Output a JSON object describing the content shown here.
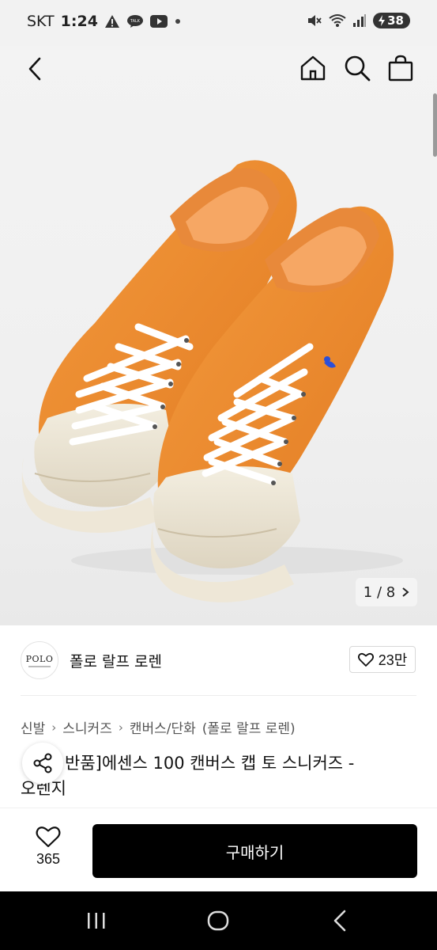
{
  "status_bar": {
    "carrier": "SKT",
    "time": "1:24",
    "battery": "38",
    "left_icons": [
      "talk-icon",
      "youtube-icon",
      "dot-icon"
    ],
    "right_icons": [
      "mute-icon",
      "wifi-icon",
      "signal-icon",
      "battery-icon"
    ]
  },
  "header": {
    "icons": [
      "back-icon",
      "home-icon",
      "search-icon",
      "bag-icon"
    ]
  },
  "gallery": {
    "counter": "1 / 8",
    "colors": {
      "canvas": "#f08a2c",
      "sole": "#ece5d3",
      "lace": "#ffffff",
      "logo": "#2b4fd8"
    }
  },
  "brand": {
    "logo_text": "POLO",
    "name": "폴로 랄프 로렌",
    "likes": "23만"
  },
  "breadcrumb": [
    "신발",
    "스니커즈",
    "캔버스/단화",
    "(폴로 랄프 로렌)"
  ],
  "product": {
    "title_line1": "반품]에센스 100 캔버스 캡 토 스니커즈 -",
    "title_line2": "오렌지"
  },
  "bottom": {
    "wish_count": "365",
    "buy_label": "구매하기",
    "buy_color": "#000000"
  }
}
